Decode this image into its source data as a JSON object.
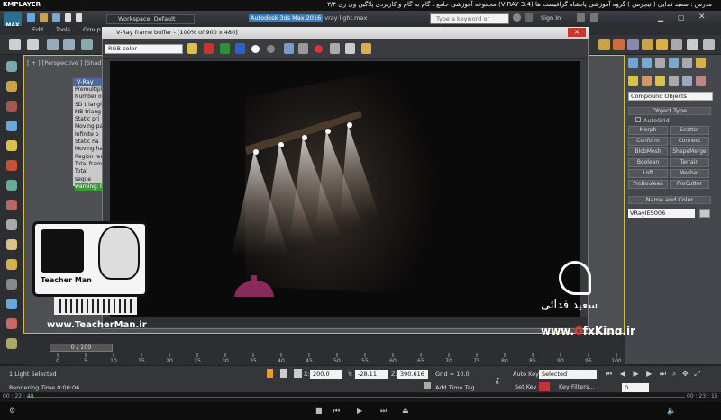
{
  "player": {
    "logo": "KMPLAYER",
    "course_title": "مجموعه آموزشی جامع ، گام به گام و کاربردی پلاگین وی ری ۳/۴  (V-RAY 3.4)  مدرس : سعید فدایی ( تیچرمن ) گروه آموزشی پادشاه گرافیست ها",
    "time_elapsed": "00 : 22 : 48",
    "time_total": "00 : 23 : 15"
  },
  "max": {
    "app_button": "MAX",
    "workspace": "Workspace: Default",
    "title_prefix": "Autodesk 3ds Max 2016",
    "title_file": "vray light.max",
    "search_placeholder": "Type a keyword or phrase",
    "sign_in": "Sign In",
    "menus": [
      "Edit",
      "Tools",
      "Group"
    ],
    "viewport_label": "[ + ] [Perspective ] [Shaded ]"
  },
  "vfb": {
    "title": "V-Ray frame buffer - [100% of 900 x 480]",
    "channel": "RGB color",
    "close": "✕"
  },
  "stats": {
    "title": "V-Ray",
    "lines": [
      "Premultiplie",
      "Number of",
      "SD triangle",
      "MB triang",
      "Static pri",
      "Moving pa",
      "Infinite p",
      "Static ha",
      "Moving ha",
      "Region ren",
      "Total frame",
      "Total seque"
    ],
    "warning": "warning: 0"
  },
  "command_panel": {
    "category": "Compound Objects",
    "object_type_title": "Object Type",
    "autogrid": "AutoGrid",
    "buttons": [
      "Morph",
      "Scatter",
      "Conform",
      "Connect",
      "BlobMesh",
      "ShapeMerge",
      "Boolean",
      "Terrain",
      "Loft",
      "Mesher",
      "ProBoolean",
      "ProCutter"
    ],
    "name_color_title": "Name and Color",
    "object_name": "VRayIES006"
  },
  "timeline": {
    "frame": "0 / 100",
    "ticks": [
      "0",
      "5",
      "10",
      "15",
      "20",
      "25",
      "30",
      "35",
      "40",
      "45",
      "50",
      "55",
      "60",
      "65",
      "70",
      "75",
      "80",
      "85",
      "90",
      "95",
      "100"
    ]
  },
  "status": {
    "selection": "1 Light Selected",
    "rendering": "Rendering Time  0:00:06",
    "x_label": "X:",
    "x_value": "200.0",
    "y_label": "Y:",
    "y_value": "-28.11",
    "z_label": "Z:",
    "z_value": "390.616",
    "grid": "Grid = 10.0",
    "add_time_tag": "Add Time Tag",
    "auto_key": "Auto Key",
    "selected": "Selected",
    "set_key": "Set Key",
    "key_filters": "Key Filters...",
    "frame_num": "0"
  },
  "overlays": {
    "teacherman_url": "www.TeacherMan.ir",
    "teacherman_brand": "Teacher Man",
    "signature": "سعید فدائی",
    "gfx_prefix": "www.",
    "gfx_red": "G",
    "gfx_rest": "fxKing.ir"
  }
}
